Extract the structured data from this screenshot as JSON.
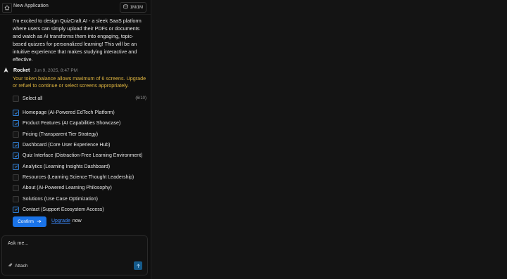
{
  "header": {
    "title": "New Application",
    "token_pill": "1M/1M"
  },
  "user_message": {
    "text": "I'm excited to design QuizCraft AI - a sleek SaaS platform where users can simply upload their PDFs or documents and watch as AI transforms them into engaging, topic-based quizzes for personalized learning! This will be an intuitive experience that makes studying interactive and effective."
  },
  "assistant": {
    "name": "Rocket",
    "timestamp": "Jun 9, 2025, 8:47 PM",
    "warning": "Your token balance allows maximum of 6 screens. Upgrade or refuel to continue or select screens appropriately."
  },
  "selection": {
    "select_all_label": "Select all",
    "count": "(6/10)",
    "items": [
      {
        "label": "Homepage (AI-Powered EdTech Platform)",
        "checked": true
      },
      {
        "label": "Product Features (AI Capabilities Showcase)",
        "checked": true
      },
      {
        "label": "Pricing (Transparent Tier Strategy)",
        "checked": false
      },
      {
        "label": "Dashboard (Core User Experience Hub)",
        "checked": true
      },
      {
        "label": "Quiz Interface (Distraction-Free Learning Environment)",
        "checked": true
      },
      {
        "label": "Analytics (Learning Insights Dashboard)",
        "checked": true
      },
      {
        "label": "Resources (Learning Science Thought Leadership)",
        "checked": false
      },
      {
        "label": "About (AI-Powered Learning Philosophy)",
        "checked": false
      },
      {
        "label": "Solutions (Use Case Optimization)",
        "checked": false
      },
      {
        "label": "Contact (Support Ecosystem Access)",
        "checked": true
      }
    ]
  },
  "actions": {
    "confirm_label": "Confirm",
    "upgrade_link": "Upgrade",
    "upgrade_suffix": "now"
  },
  "composer": {
    "placeholder": "Ask me...",
    "attach_label": "Attach"
  },
  "colors": {
    "accent": "#1a73e8",
    "warning": "#e0b640",
    "link": "#3d8bff"
  }
}
